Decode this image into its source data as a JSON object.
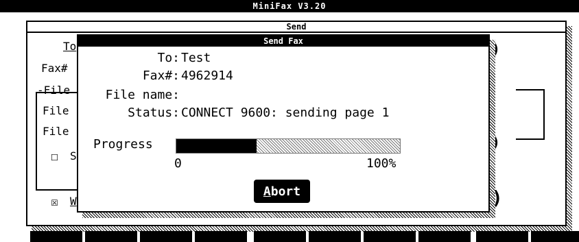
{
  "app": {
    "title": "MiniFax  V3.20"
  },
  "send_window": {
    "title": "Send",
    "labels": {
      "to": "To",
      "fax": "Fax#",
      "file_group": "-File",
      "file1": "File",
      "file2": "File",
      "checkbox_partial": "S",
      "checkbox_bottom": "W"
    }
  },
  "send_fax_dialog": {
    "title": "Send Fax",
    "to_label": "To:",
    "to_value": "Test",
    "fax_label": "Fax#:",
    "fax_value": "4962914",
    "file_label": "File name:",
    "file_value": "",
    "status_label": "Status:",
    "status_value": "CONNECT 9600: sending page 1",
    "progress_label": "Progress",
    "progress_value": 0.36,
    "progress_min": "0",
    "progress_max": "100%",
    "abort_button_rest": "bort",
    "abort_hotkey": "A"
  }
}
